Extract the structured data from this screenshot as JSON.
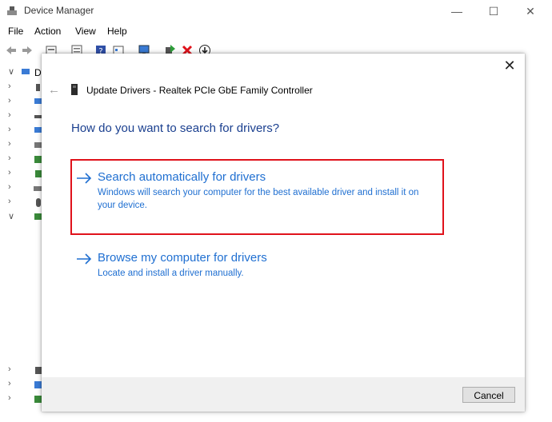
{
  "window": {
    "title": "Device Manager",
    "minimize": "—",
    "maximize": "☐",
    "close": "✕"
  },
  "menu": [
    "File",
    "Action",
    "View",
    "Help"
  ],
  "tree": {
    "root_label": "D"
  },
  "dialog": {
    "close": "✕",
    "back": "←",
    "title": "Update Drivers - Realtek PCIe GbE Family Controller",
    "question": "How do you want to search for drivers?",
    "options": [
      {
        "title": "Search automatically for drivers",
        "description": "Windows will search your computer for the best available driver and install it on your device.",
        "highlighted": true
      },
      {
        "title": "Browse my computer for drivers",
        "description": "Locate and install a driver manually.",
        "highlighted": false
      }
    ],
    "cancel_label": "Cancel"
  },
  "colors": {
    "link_blue": "#1f6fd1",
    "question_blue": "#1a3f8f",
    "highlight_red": "#e0121b"
  }
}
